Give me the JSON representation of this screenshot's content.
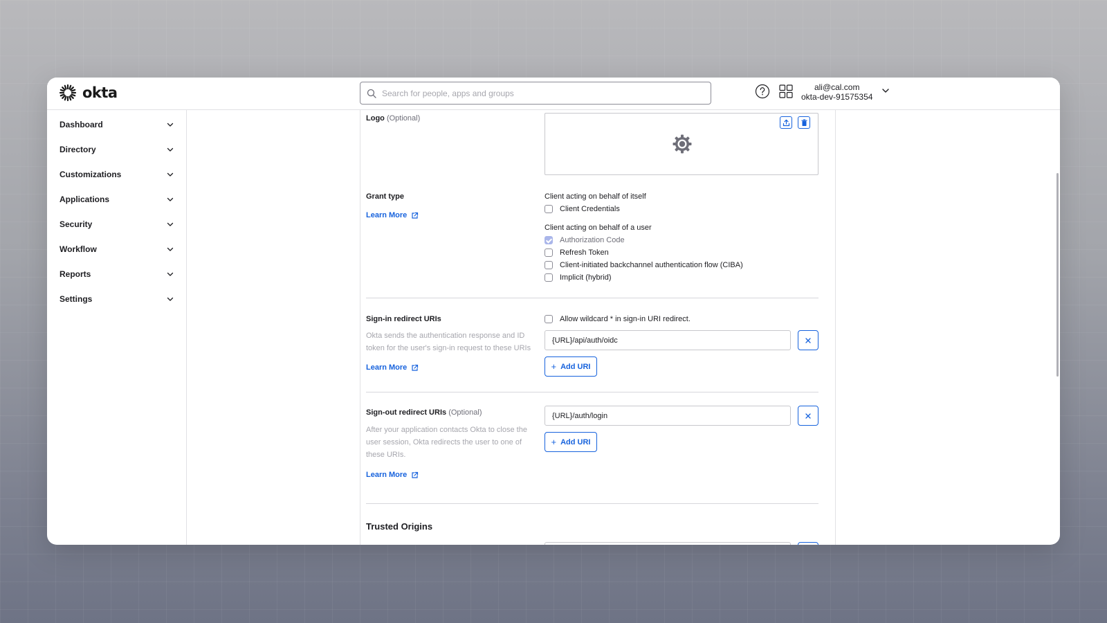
{
  "header": {
    "logo_text": "okta",
    "search_placeholder": "Search for people, apps and groups",
    "user_email": "ali@cal.com",
    "user_org": "okta-dev-91575354"
  },
  "sidebar": {
    "items": [
      {
        "label": "Dashboard"
      },
      {
        "label": "Directory"
      },
      {
        "label": "Customizations"
      },
      {
        "label": "Applications"
      },
      {
        "label": "Security"
      },
      {
        "label": "Workflow"
      },
      {
        "label": "Reports"
      },
      {
        "label": "Settings"
      }
    ]
  },
  "logo_section": {
    "label": "Logo",
    "optional": "(Optional)"
  },
  "grant_type": {
    "label": "Grant type",
    "learn_more": "Learn More",
    "self_heading": "Client acting on behalf of itself",
    "self_options": [
      {
        "label": "Client Credentials",
        "checked": false
      }
    ],
    "user_heading": "Client acting on behalf of a user",
    "user_options": [
      {
        "label": "Authorization Code",
        "checked": true
      },
      {
        "label": "Refresh Token",
        "checked": false
      },
      {
        "label": "Client-initiated backchannel authentication flow (CIBA)",
        "checked": false
      },
      {
        "label": "Implicit (hybrid)",
        "checked": false
      }
    ]
  },
  "signin": {
    "label": "Sign-in redirect URIs",
    "desc": "Okta sends the authentication response and ID token for the user's sign-in request to these URIs",
    "learn_more": "Learn More",
    "wildcard_label": "Allow wildcard * in sign-in URI redirect.",
    "uri_value": "{URL}/api/auth/oidc",
    "add_label": "Add URI"
  },
  "signout": {
    "label": "Sign-out redirect URIs",
    "optional": "(Optional)",
    "desc": "After your application contacts Okta to close the user session, Okta redirects the user to one of these URIs.",
    "learn_more": "Learn More",
    "uri_value": "{URL}/auth/login",
    "add_label": "Add URI"
  },
  "trusted_origins": {
    "heading": "Trusted Origins"
  },
  "colors": {
    "accent": "#1662dd",
    "checked": "#aab6ea"
  }
}
